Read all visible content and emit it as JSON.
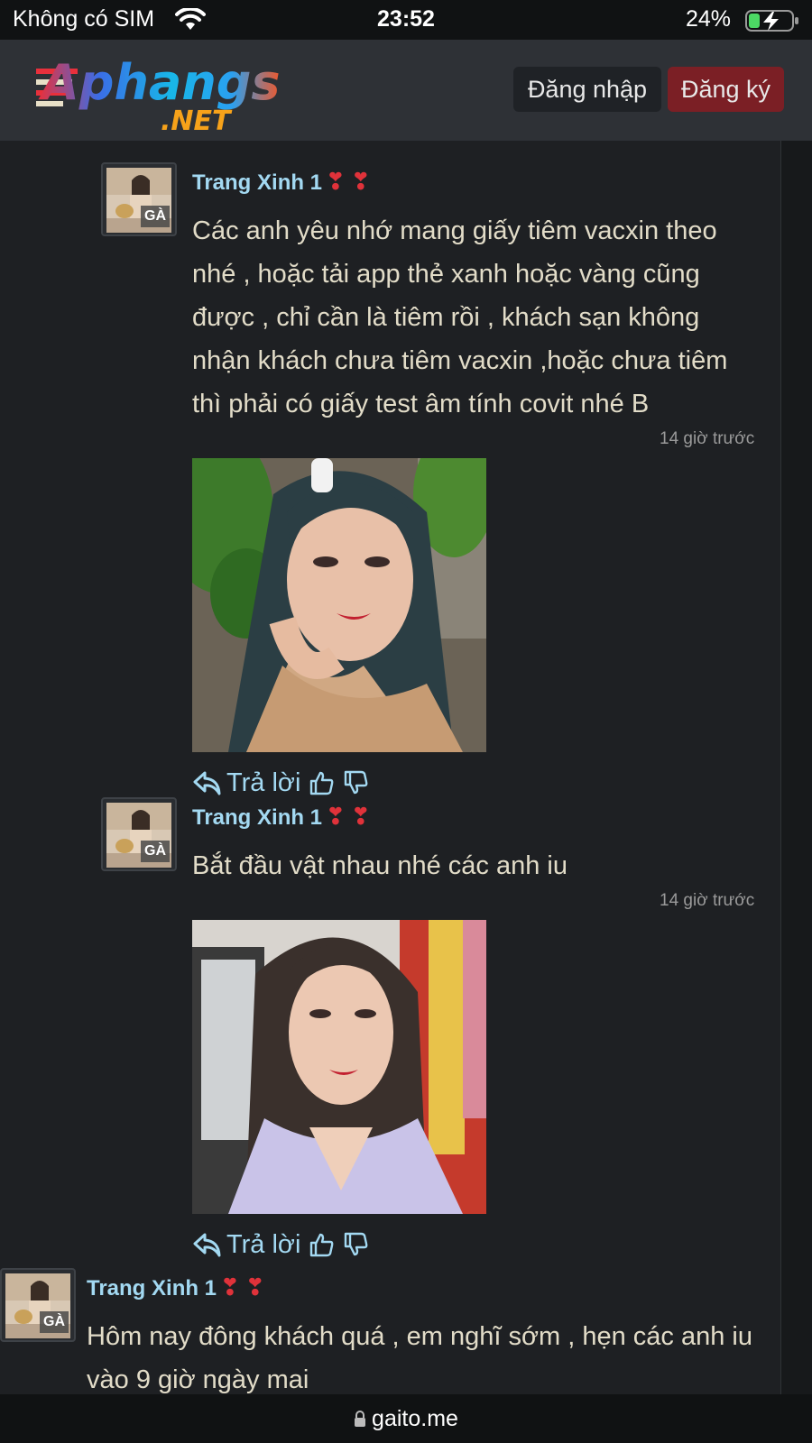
{
  "status_bar": {
    "carrier": "Không có SIM",
    "time": "23:52",
    "battery": "24%"
  },
  "header": {
    "logo_main": "Aphangs",
    "logo_sub": ".NET",
    "login_label": "Đăng nhập",
    "register_label": "Đăng ký"
  },
  "comments": [
    {
      "author": "Trang Xinh 1",
      "hearts": "❣❣",
      "badge": "GÀ",
      "text": "Các anh yêu nhớ mang giấy tiêm vacxin theo nhé , hoặc tải app thẻ xanh hoặc vàng cũng được , chỉ cần là tiêm rồi , khách sạn không nhận khách chưa tiêm vacxin ,hoặc chưa tiêm thì phải có giấy test âm tính covit nhé B",
      "timestamp": "14 giờ trước",
      "reply_label": "Trả lời"
    },
    {
      "author": "Trang Xinh 1",
      "hearts": "❣❣",
      "badge": "GÀ",
      "text": "Bắt đầu vật nhau nhé các anh iu",
      "timestamp": "14 giờ trước",
      "reply_label": "Trả lời"
    },
    {
      "author": "Trang Xinh 1",
      "hearts": "❣❣",
      "badge": "GÀ",
      "text": "Hôm nay đông khách quá , em nghĩ sớm , hẹn các anh iu vào 9 giờ ngày mai"
    }
  ],
  "url_bar": {
    "domain": "gaito.me"
  },
  "colors": {
    "accent_link": "#a3d9f2",
    "register_button": "#7b1f25",
    "background": "#1e2023"
  }
}
